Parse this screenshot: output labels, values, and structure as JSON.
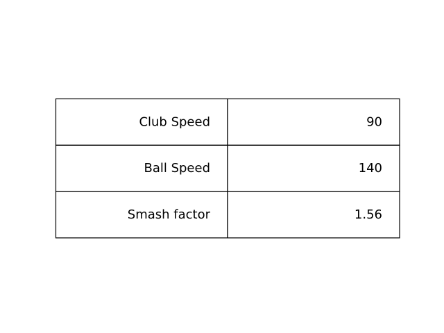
{
  "chart_data": {
    "type": "table",
    "rows": [
      [
        "Club Speed",
        "90"
      ],
      [
        "Ball Speed",
        "140"
      ],
      [
        "Smash factor",
        "1.56"
      ]
    ]
  }
}
